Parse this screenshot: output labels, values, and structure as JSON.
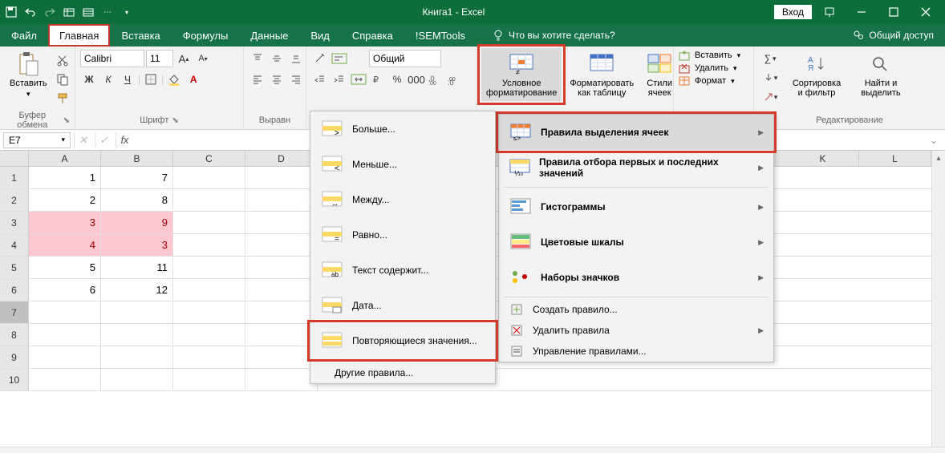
{
  "titlebar": {
    "doc_title": "Книга1 - Excel",
    "signin": "Вход"
  },
  "tabs": {
    "file": "Файл",
    "home": "Главная",
    "insert": "Вставка",
    "formulas": "Формулы",
    "data": "Данные",
    "view": "Вид",
    "help": "Справка",
    "semtools": "!SEMTools",
    "tellme": "Что вы хотите сделать?",
    "share": "Общий доступ"
  },
  "ribbon": {
    "clipboard": {
      "paste": "Вставить",
      "group": "Буфер обмена"
    },
    "font": {
      "name": "Calibri",
      "size": "11",
      "group": "Шрифт"
    },
    "align": {
      "group": "Выравн"
    },
    "number": {
      "format": "Общий"
    },
    "styles": {
      "cond_fmt": "Условное форматирование",
      "as_table": "Форматировать как таблицу",
      "cell_styles": "Стили ячеек"
    },
    "cells": {
      "insert": "Вставить",
      "delete": "Удалить",
      "format": "Формат"
    },
    "editing": {
      "sort": "Сортировка и фильтр",
      "find": "Найти и выделить",
      "group": "Редактирование"
    }
  },
  "formulabar": {
    "name": "E7"
  },
  "columns": [
    "A",
    "B",
    "C",
    "D",
    "K",
    "L"
  ],
  "rows": [
    {
      "n": "1",
      "a": "1",
      "b": "7"
    },
    {
      "n": "2",
      "a": "2",
      "b": "8"
    },
    {
      "n": "3",
      "a": "3",
      "b": "9",
      "hl": true
    },
    {
      "n": "4",
      "a": "4",
      "b": "3",
      "hl": true
    },
    {
      "n": "5",
      "a": "5",
      "b": "11"
    },
    {
      "n": "6",
      "a": "6",
      "b": "12"
    },
    {
      "n": "7",
      "a": "",
      "b": "",
      "sel": true
    },
    {
      "n": "8",
      "a": "",
      "b": ""
    },
    {
      "n": "9",
      "a": "",
      "b": ""
    },
    {
      "n": "10",
      "a": "",
      "b": ""
    }
  ],
  "menu1": {
    "greater": "Больше...",
    "less": "Меньше...",
    "between": "Между...",
    "equal": "Равно...",
    "contains": "Текст содержит...",
    "date": "Дата...",
    "duplicates": "Повторяющиеся значения...",
    "other": "Другие правила..."
  },
  "menu2": {
    "highlight_rules": "Правила выделения ячеек",
    "top_bottom": "Правила отбора первых и последних значений",
    "databars": "Гистограммы",
    "colorscales": "Цветовые шкалы",
    "iconsets": "Наборы значков",
    "new_rule": "Создать правило...",
    "clear_rules": "Удалить правила",
    "manage": "Управление правилами..."
  }
}
